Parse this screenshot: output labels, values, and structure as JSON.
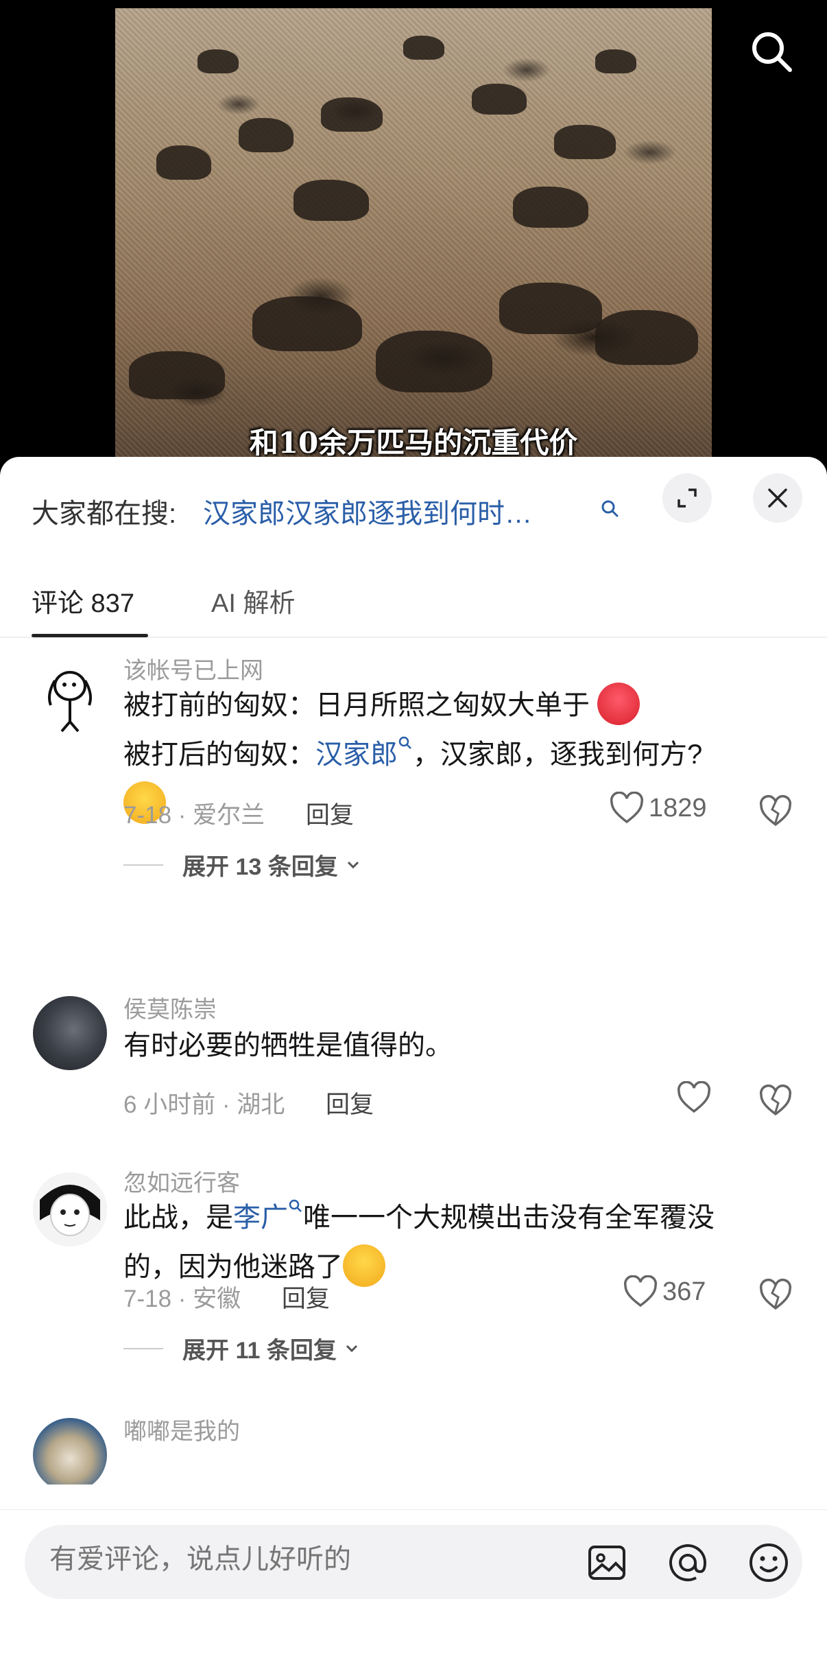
{
  "video": {
    "subtitle": "和10余万匹马的沉重代价"
  },
  "hot_search": {
    "prefix": "大家都在搜:",
    "query": "汉家郎汉家郎逐我到何时…"
  },
  "tabs": [
    {
      "label": "评论 837",
      "active": true
    },
    {
      "label": "AI 解析",
      "active": false
    }
  ],
  "comments": [
    {
      "username": "该帐号已上网",
      "text1": "被打前的匈奴：日月所照之匈奴大单于",
      "text2_prefix": "被打后的匈奴：",
      "text2_link": "汉家郎",
      "text2_suffix": "，汉家郎，逐我到何方?",
      "date_location": "7-18 · 爱尔兰",
      "reply_label": "回复",
      "likes": "1829",
      "expand_label": "展开 13 条回复"
    },
    {
      "username": "侯莫陈崇",
      "text1": "有时必要的牺牲是值得的。",
      "date_location": "6 小时前 · 湖北",
      "reply_label": "回复",
      "likes": ""
    },
    {
      "username": "忽如远行客",
      "text1_prefix": "此战，是",
      "text1_link": "李广",
      "text1_suffix": "唯一一个大规模出击没有全军覆没",
      "text2": "的，因为他迷路了",
      "date_location": "7-18 · 安徽",
      "reply_label": "回复",
      "likes": "367",
      "expand_label": "展开 11 条回复"
    },
    {
      "username": "嘟嘟是我的"
    }
  ],
  "input": {
    "placeholder": "有爱评论，说点儿好听的"
  },
  "colors": {
    "link": "#2a5ea8",
    "muted": "#9b9b9b"
  }
}
